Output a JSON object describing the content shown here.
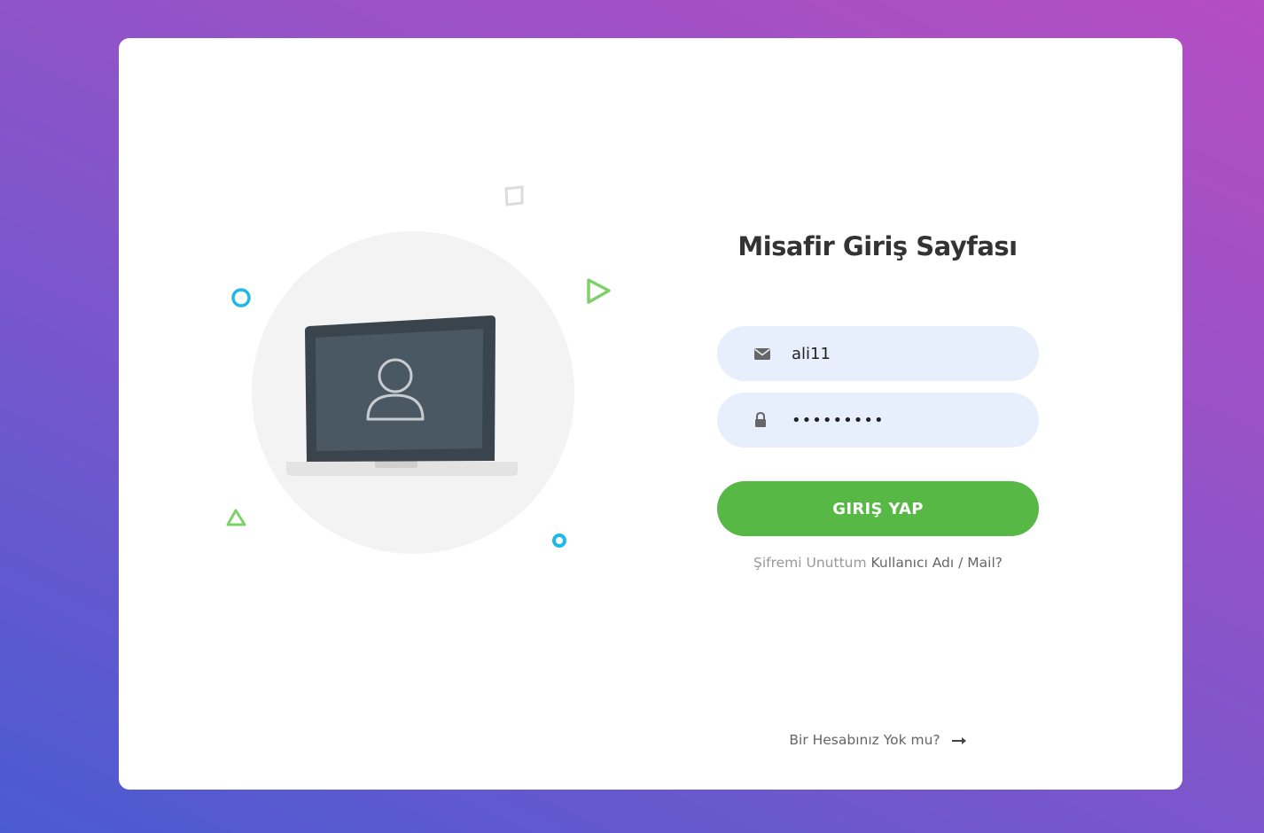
{
  "page": {
    "title": "Misafir Giriş Sayfası"
  },
  "form": {
    "email_value": "ali11",
    "password_value": "•••••••••",
    "email_icon": "envelope-icon",
    "password_icon": "lock-icon",
    "submit_label": "GIRIŞ YAP"
  },
  "forgot": {
    "prefix": "Şifremi Unuttum",
    "link": "Kullanıcı Adı / Mail?"
  },
  "signup": {
    "label": "Bir Hesabınız Yok mu?",
    "icon": "arrow-right-icon"
  },
  "colors": {
    "button": "#57b846",
    "input_bg": "#e8effc",
    "title": "#333333"
  }
}
